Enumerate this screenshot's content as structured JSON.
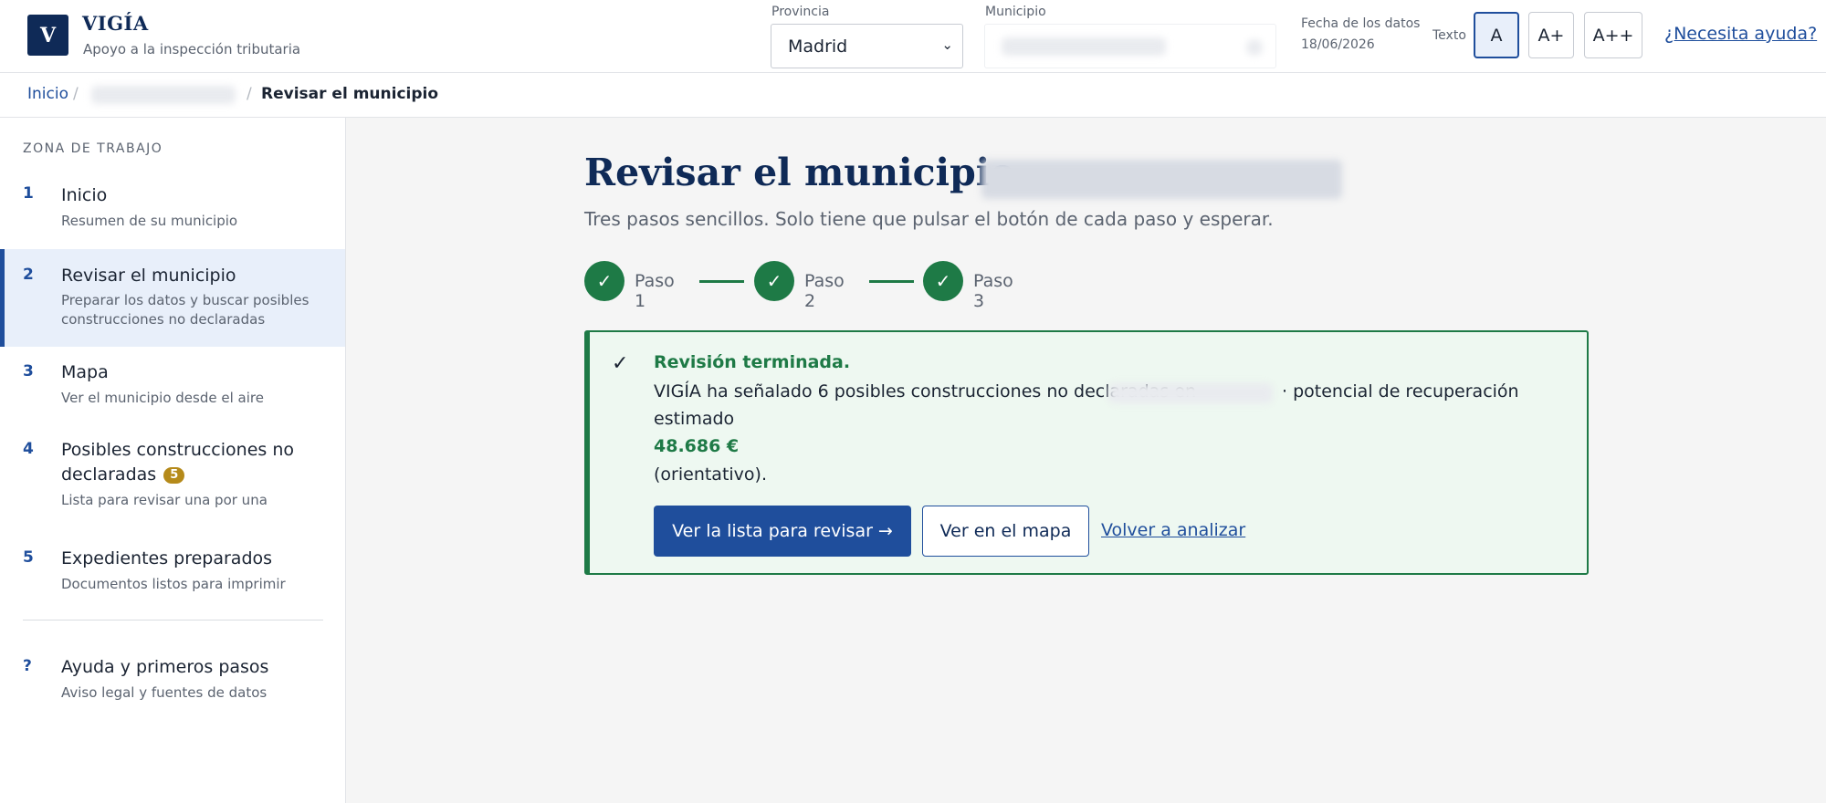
{
  "app": {
    "logo_letter": "V",
    "title": "VIGÍA",
    "subtitle": "Apoyo a la inspección tributaria"
  },
  "header": {
    "province_label": "Provincia",
    "province_value": "Madrid",
    "municipality_label": "Municipio",
    "date_label": "Fecha de los datos",
    "date_value": "18/06/2026",
    "text_size_label": "Texto",
    "text_sizes": [
      "A",
      "A+",
      "A++"
    ],
    "help_link": "¿Necesita ayuda?"
  },
  "breadcrumb": {
    "home": "Inicio",
    "separator": "/",
    "current": "Revisar el municipio"
  },
  "sidebar": {
    "zone_title": "ZONA DE TRABAJO",
    "items": [
      {
        "num": "1",
        "label": "Inicio",
        "desc": "Resumen de su municipio"
      },
      {
        "num": "2",
        "label": "Revisar el municipio",
        "desc_line1": "Preparar los datos y buscar posibles",
        "desc_line2": "construcciones no declaradas"
      },
      {
        "num": "3",
        "label": "Mapa",
        "desc": "Ver el municipio desde el aire"
      },
      {
        "num": "4",
        "label_line1": "Posibles construcciones no",
        "label_line2": "declaradas",
        "badge": "5",
        "desc": "Lista para revisar una por una"
      },
      {
        "num": "5",
        "label": "Expedientes preparados",
        "desc": "Documentos listos para imprimir"
      }
    ],
    "help": {
      "num": "?",
      "label": "Ayuda y primeros pasos",
      "desc": "Aviso legal y fuentes de datos"
    }
  },
  "main": {
    "title": "Revisar el municipio ·",
    "subtitle": "Tres pasos sencillos. Solo tiene que pulsar el botón de cada paso y esperar.",
    "steps": [
      {
        "label": "Paso 1",
        "icon": "check-icon"
      },
      {
        "label": "Paso 2",
        "icon": "check-icon"
      },
      {
        "label": "Paso 3",
        "icon": "check-icon"
      }
    ],
    "result": {
      "check": "✓",
      "title": "Revisión terminada.",
      "line1_part1": "VIGÍA ha señalado 6 posibles construcciones no declaradas en",
      "line1_part2": "· potencial de recuperación",
      "line2": "estimado",
      "amount": "48.686 €",
      "note": "(orientativo).",
      "primary_button": "Ver la lista para revisar →",
      "secondary_button": "Ver en el mapa",
      "reanalyze_link": "Volver a analizar"
    }
  },
  "colors": {
    "brand_navy": "#0f2a57",
    "link_blue": "#1f4e9c",
    "success_green": "#1e7a46",
    "badge_gold": "#b58a1a"
  }
}
